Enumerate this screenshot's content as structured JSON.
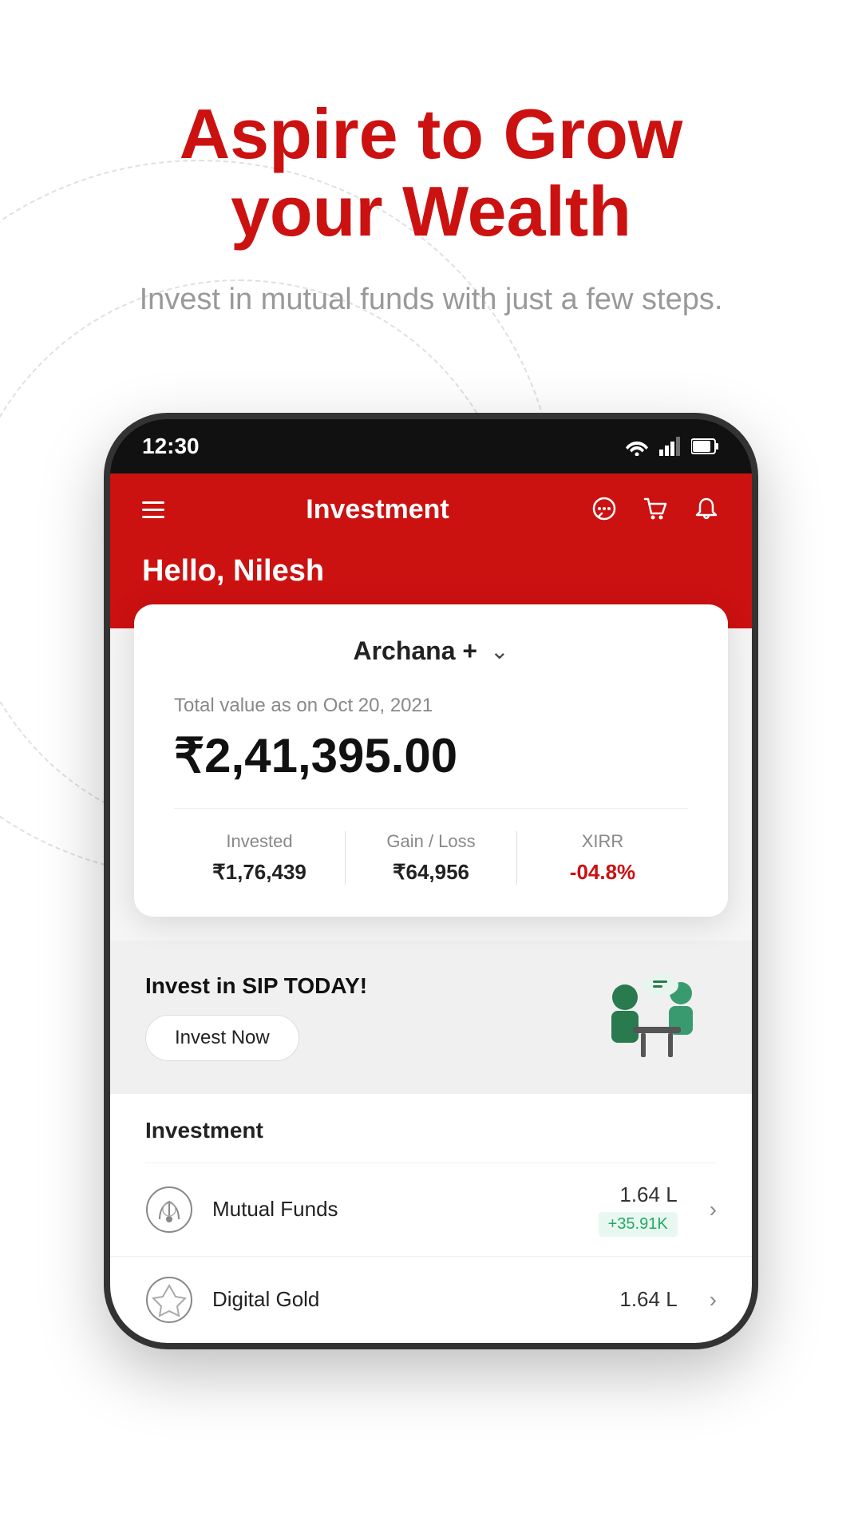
{
  "hero": {
    "title_line1": "Aspire to Grow",
    "title_line2": "your Wealth",
    "subtitle": "Invest in mutual funds with just a few steps."
  },
  "phone": {
    "status_bar": {
      "time": "12:30"
    },
    "app_bar": {
      "title": "Investment"
    },
    "greeting": "Hello, Nilesh"
  },
  "portfolio_card": {
    "account_name": "Archana +",
    "total_value_label": "Total value as on Oct 20, 2021",
    "total_value": "₹2,41,395.00",
    "stats": {
      "invested_label": "Invested",
      "invested_value": "₹1,76,439",
      "gain_loss_label": "Gain / Loss",
      "gain_loss_value": "₹64,956",
      "xirr_label": "XIRR",
      "xirr_value": "-04.8%"
    }
  },
  "sip_banner": {
    "title": "Invest in SIP TODAY!",
    "button_label": "Invest Now"
  },
  "investment_section": {
    "title": "Investment",
    "items": [
      {
        "name": "Mutual Funds",
        "amount": "1.64 L",
        "gain": "+35.91K"
      },
      {
        "name": "Digital Gold",
        "amount": "1.64 L",
        "gain": ""
      }
    ]
  }
}
